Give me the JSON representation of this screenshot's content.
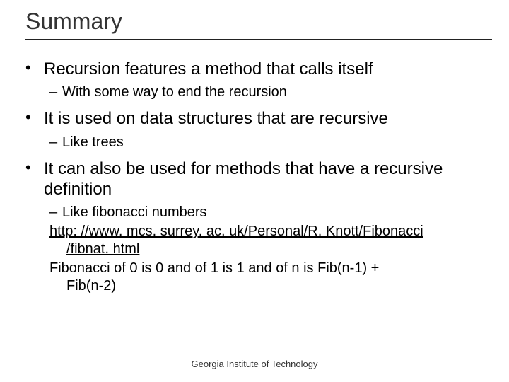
{
  "title": "Summary",
  "bullets": [
    {
      "text": "Recursion features a method that calls itself",
      "subs": [
        {
          "text": "With some way to end the recursion"
        }
      ]
    },
    {
      "text": "It is used on data structures that are recursive",
      "subs": [
        {
          "text": "Like trees"
        }
      ]
    },
    {
      "text": "It can also be used for methods that have a recursive definition",
      "subs": [
        {
          "text": "Like fibonacci numbers"
        },
        {
          "link_line1": "http: //www. mcs. surrey. ac. uk/Personal/R. Knott/Fibonacci",
          "link_line2": "/fibnat. html"
        },
        {
          "plain_line1": "Fibonacci of 0 is 0 and of 1 is 1 and of n is Fib(n-1) +",
          "plain_line2": "Fib(n-2)"
        }
      ]
    }
  ],
  "footer": "Georgia Institute of Technology"
}
